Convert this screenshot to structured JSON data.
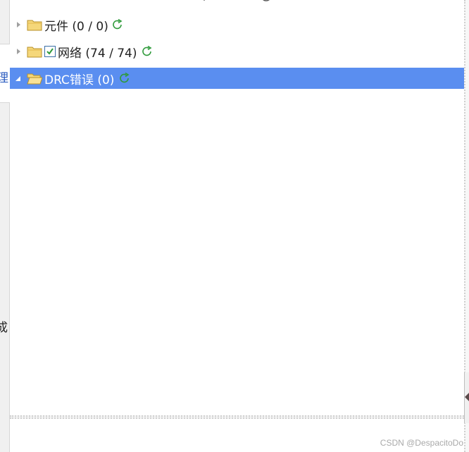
{
  "left_panel": {
    "tab_char_top": "理",
    "tab_char_bottom": "成"
  },
  "tree": {
    "items": [
      {
        "label": "元件 (0 / 0)",
        "expanded": false,
        "checked": false,
        "selected": false
      },
      {
        "label": "网络 (74 / 74)",
        "expanded": false,
        "checked": true,
        "selected": false
      },
      {
        "label": "DRC错误 (0)",
        "expanded": true,
        "checked": false,
        "selected": true
      }
    ]
  },
  "watermark": "CSDN @DespacitoDo",
  "colors": {
    "selection": "#5a8ef0",
    "refresh_icon": "#2e9a3a",
    "folder_fill": "#f5d77a",
    "folder_stroke": "#b8912a"
  }
}
